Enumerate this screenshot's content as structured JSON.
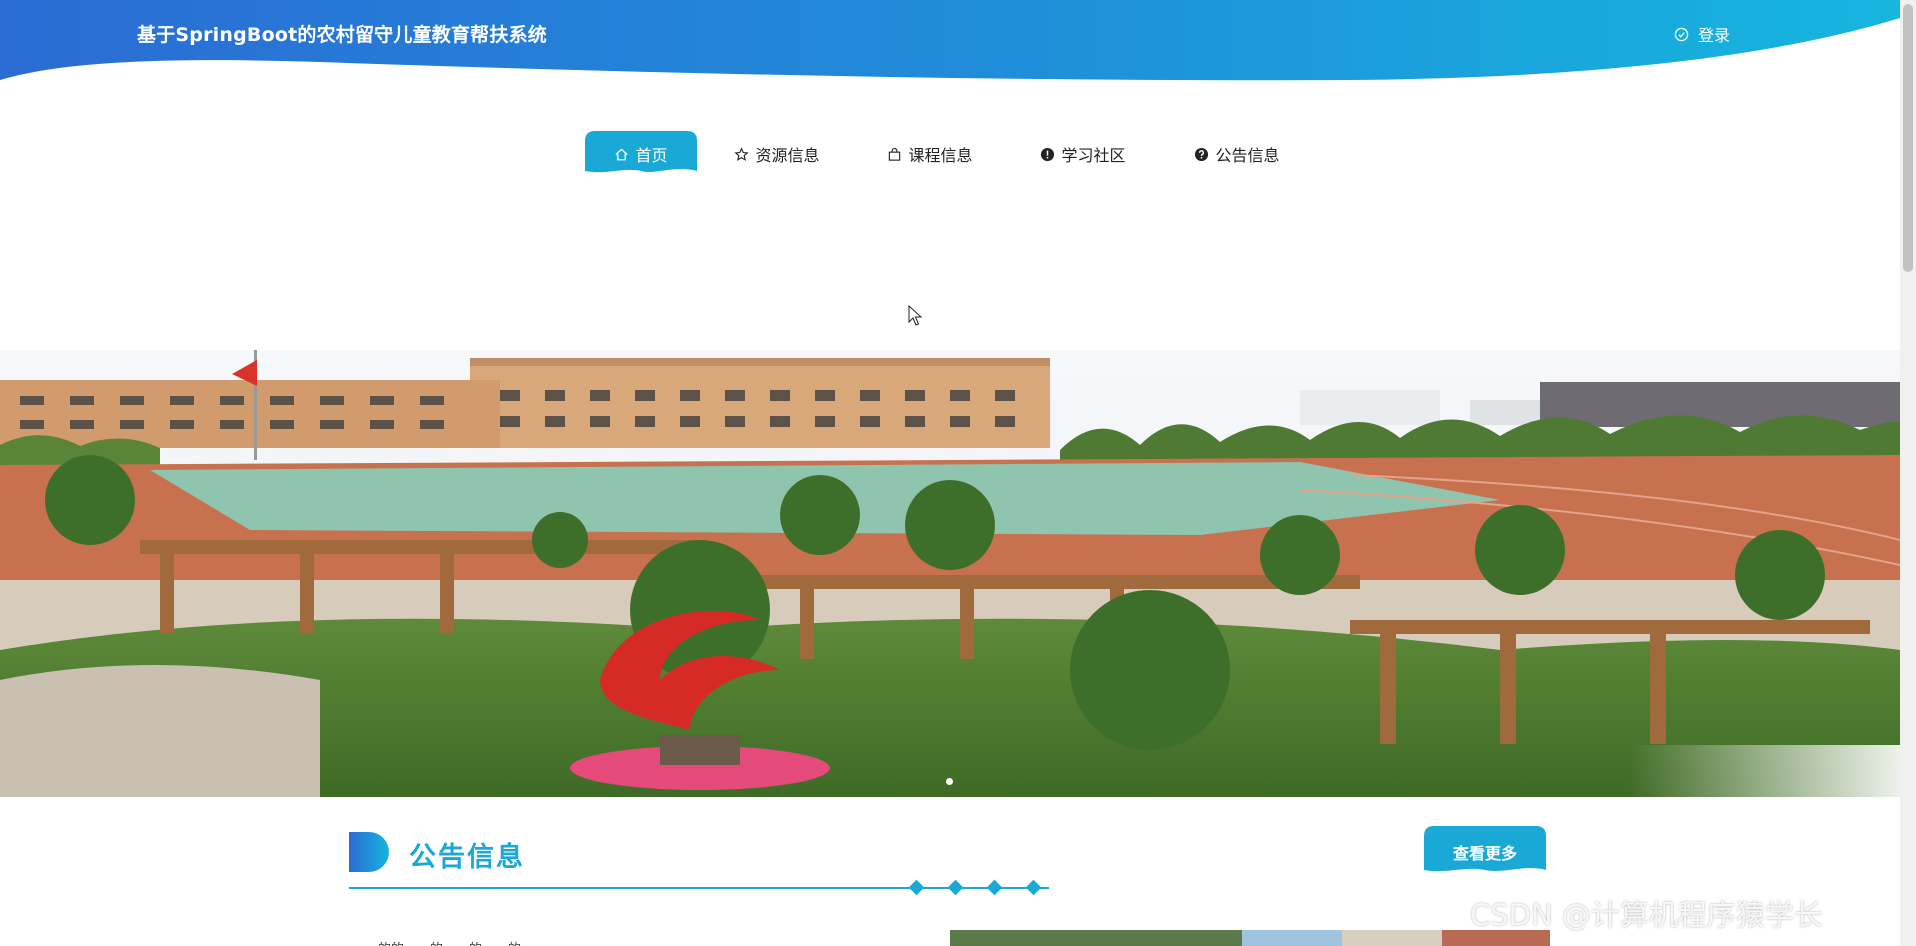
{
  "header": {
    "site_title": "基于SpringBoot的农村留守儿童教育帮扶系统",
    "login_label": "登录",
    "login_icon": "check-circle-icon",
    "gradient_start": "#2b6fd6",
    "gradient_end": "#17b3de"
  },
  "nav": {
    "items": [
      {
        "label": "首页",
        "icon": "home-icon",
        "active": true
      },
      {
        "label": "资源信息",
        "icon": "star-icon",
        "active": false
      },
      {
        "label": "课程信息",
        "icon": "bag-icon",
        "active": false
      },
      {
        "label": "学习社区",
        "icon": "exclamation-circle-icon",
        "active": false
      },
      {
        "label": "公告信息",
        "icon": "question-circle-icon",
        "active": false
      }
    ],
    "active_color": "#1aa9d6"
  },
  "banner": {
    "slide_count": 1,
    "current_slide": 1
  },
  "notice_section": {
    "title": "公告信息",
    "more_label": "查看更多",
    "accent_color": "#1aa9d6",
    "snippet": "……的的……的……的……的……"
  },
  "watermark": "CSDN @计算机程序猿学长"
}
